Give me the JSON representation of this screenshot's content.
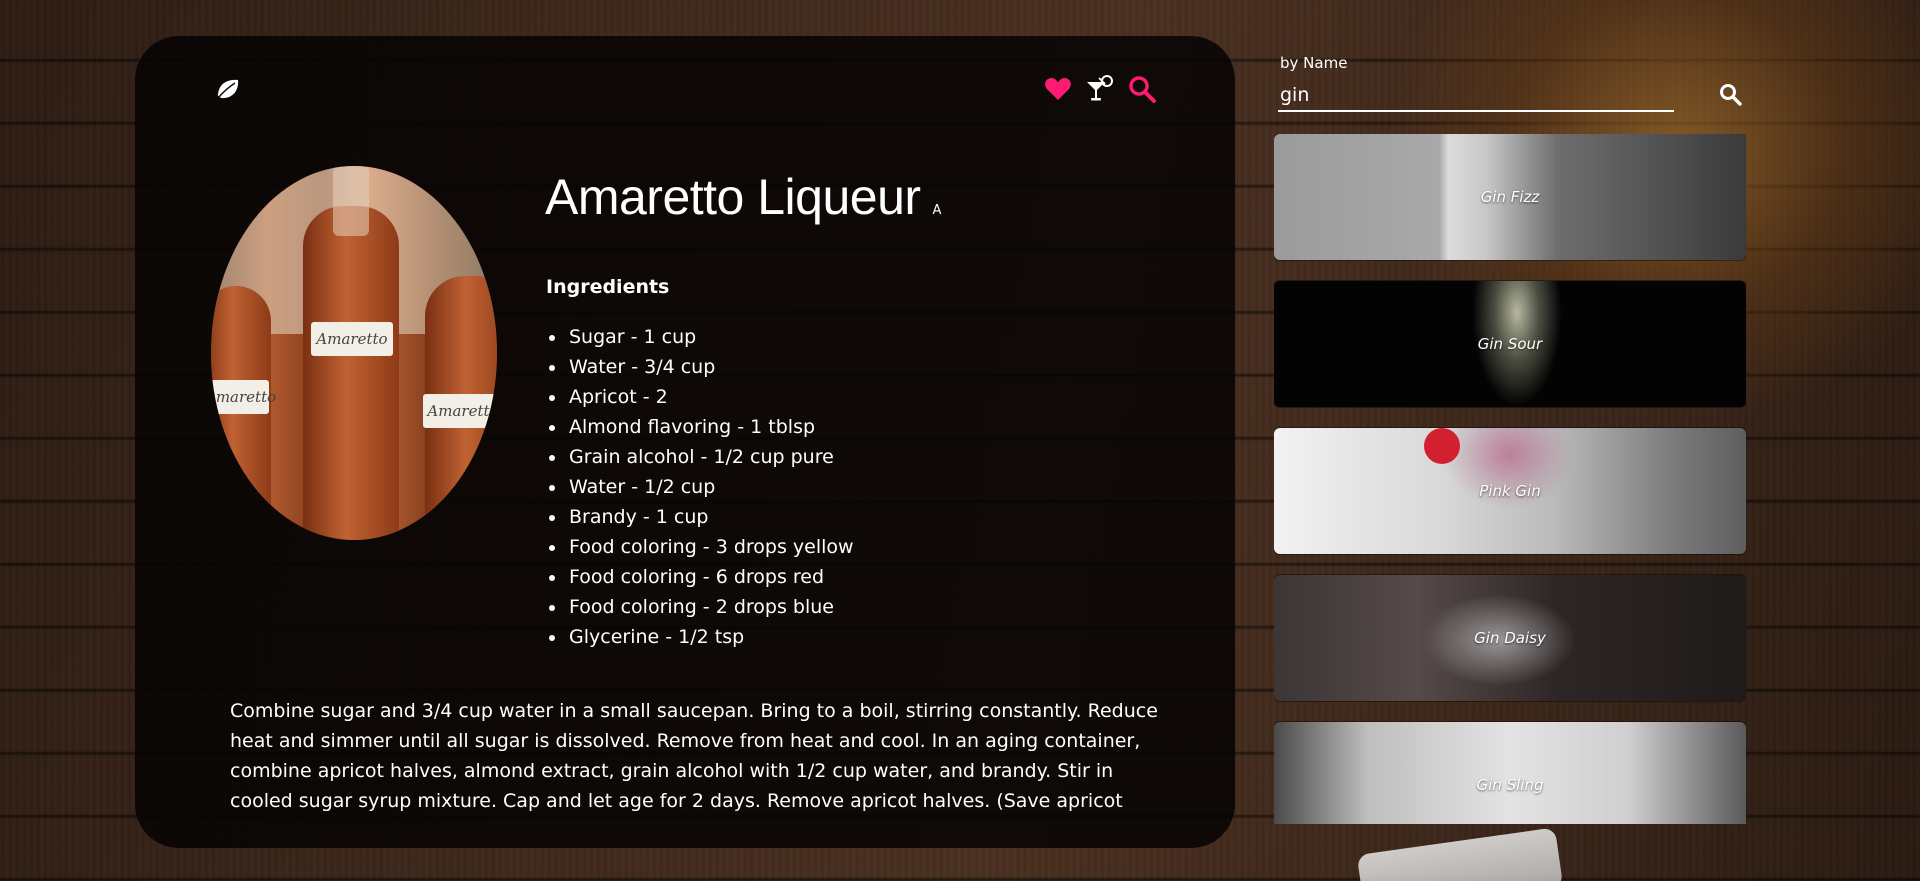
{
  "detail": {
    "title": "Amaretto Liqueur",
    "alcoholic_badge": "A",
    "ingredients_heading": "Ingredients",
    "ingredients": [
      "Sugar - 1 cup",
      "Water - 3/4 cup",
      "Apricot - 2",
      "Almond flavoring - 1 tblsp",
      "Grain alcohol - 1/2 cup pure",
      "Water - 1/2 cup",
      "Brandy - 1 cup",
      "Food coloring - 3 drops yellow",
      "Food coloring - 6 drops red",
      "Food coloring - 2 drops blue",
      "Glycerine - 1/2 tsp"
    ],
    "instructions": "Combine sugar and 3/4 cup water in a small saucepan. Bring to a boil, stirring constantly. Reduce heat and simmer until all sugar is dissolved. Remove from heat and cool. In an aging container, combine apricot halves, almond extract, grain alcohol with 1/2 cup water, and brandy. Stir in cooled sugar syrup mixture. Cap and let age for 2 days. Remove apricot halves. (Save apricot halves and use for cooking.)",
    "photo_labels": [
      "Amaretto",
      "Amaretto",
      "Amaretto"
    ]
  },
  "nav": {
    "icons": [
      "leaf-logo-icon",
      "heart-icon",
      "cocktail-glass-icon",
      "search-icon"
    ],
    "accent_color": "#ff1a73"
  },
  "search": {
    "label": "by Name",
    "value": "gin",
    "button_icon": "search-icon"
  },
  "results": [
    {
      "name": "Gin Fizz"
    },
    {
      "name": "Gin Sour"
    },
    {
      "name": "Pink Gin"
    },
    {
      "name": "Gin Daisy"
    },
    {
      "name": "Gin Sling"
    }
  ]
}
